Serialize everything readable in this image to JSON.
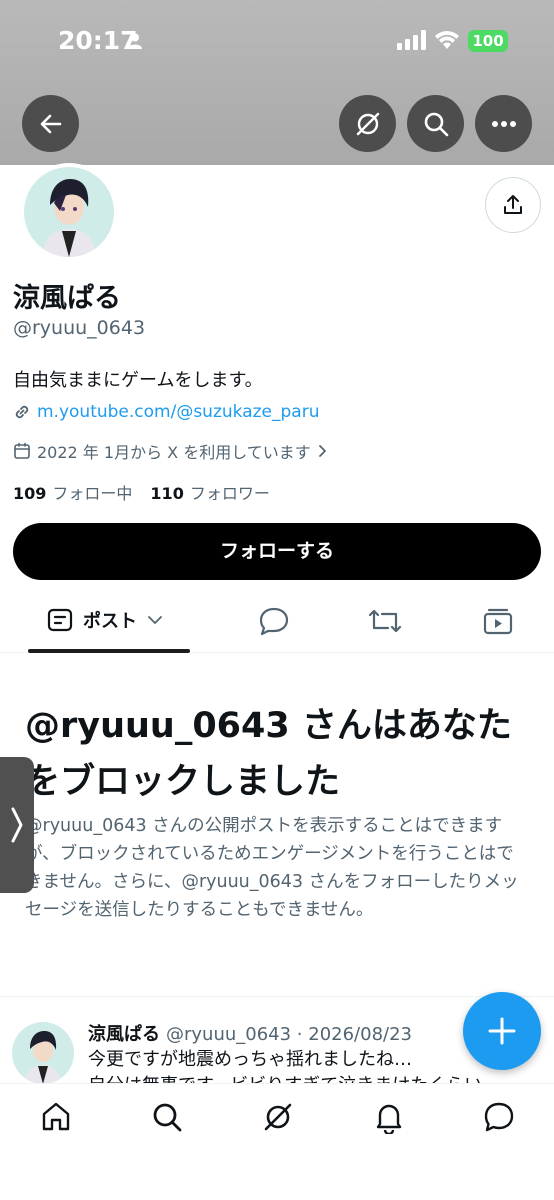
{
  "status_bar": {
    "time": "20:17",
    "battery": "100"
  },
  "header": {
    "back": "back-icon",
    "grok": "grok-icon",
    "search": "search-icon",
    "more": "more-icon"
  },
  "profile": {
    "display_name": "涼風ぱる",
    "handle": "@ryuuu_0643",
    "bio": "自由気ままにゲームをします。",
    "link": "m.youtube.com/@suzukaze_paru",
    "joined": "2022 年 1月から X を利用しています",
    "following_count": "109",
    "following_label": "フォロー中",
    "followers_count": "110",
    "followers_label": "フォロワー",
    "follow_button": "フォローする"
  },
  "tabs": {
    "post_label": "ポスト"
  },
  "blocked": {
    "title": "@ryuuu_0643 さんはあなたをブロックしました",
    "description": "@ryuuu_0643 さんの公開ポストを表示することはできますが、ブロックされているためエンゲージメントを行うことはできません。さらに、@ryuuu_0643 さんをフォローしたりメッセージを送信したりすることもできません。"
  },
  "tweet": {
    "name": "涼風ぱる",
    "handle_date": "@ryuuu_0643 · 2026/08/23",
    "line1": "今更ですが地震めっちゃ揺れましたね…",
    "line2": "自分は無事です。ビビりすぎて泣きまけたくらい"
  },
  "colors": {
    "accent": "#1d9bf0",
    "text": "#0f1419",
    "muted": "#536471",
    "button": "#000000"
  }
}
